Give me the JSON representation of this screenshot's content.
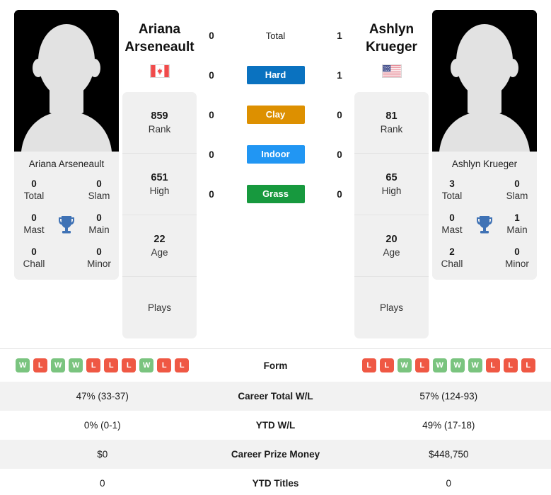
{
  "colors": {
    "hard": "#0a72c0",
    "clay": "#dd9000",
    "indoor": "#2196f3",
    "grass": "#17993e",
    "win": "#7ac47f",
    "loss": "#ef5844",
    "trophy": "#3f72b5",
    "card_bg": "#f0f0f0",
    "row_alt": "#f2f2f2"
  },
  "player1": {
    "name": "Ariana Arseneault",
    "first_name": "Ariana",
    "last_name": "Arseneault",
    "country": "Canada",
    "flag_icon": "flag-canada-icon",
    "avatar_icon": "player-silhouette-icon",
    "rank": "859",
    "rank_label": "Rank",
    "high": "651",
    "high_label": "High",
    "age": "22",
    "age_label": "Age",
    "plays": "",
    "plays_label": "Plays",
    "titles": {
      "total": "0",
      "total_label": "Total",
      "slam": "0",
      "slam_label": "Slam",
      "mast": "0",
      "mast_label": "Mast",
      "main": "0",
      "main_label": "Main",
      "chall": "0",
      "chall_label": "Chall",
      "minor": "0",
      "minor_label": "Minor"
    },
    "h2h": {
      "total": "0",
      "hard": "0",
      "clay": "0",
      "indoor": "0",
      "grass": "0"
    },
    "form": [
      "W",
      "L",
      "W",
      "W",
      "L",
      "L",
      "L",
      "W",
      "L",
      "L"
    ],
    "career_total_wl": "47% (33-37)",
    "ytd_wl": "0% (0-1)",
    "career_prize_money": "$0",
    "ytd_titles": "0"
  },
  "player2": {
    "name": "Ashlyn Krueger",
    "first_name": "Ashlyn",
    "last_name": "Krueger",
    "country": "United States",
    "flag_icon": "flag-usa-icon",
    "avatar_icon": "player-silhouette-icon",
    "rank": "81",
    "rank_label": "Rank",
    "high": "65",
    "high_label": "High",
    "age": "20",
    "age_label": "Age",
    "plays": "",
    "plays_label": "Plays",
    "titles": {
      "total": "3",
      "total_label": "Total",
      "slam": "0",
      "slam_label": "Slam",
      "mast": "0",
      "mast_label": "Mast",
      "main": "1",
      "main_label": "Main",
      "chall": "2",
      "chall_label": "Chall",
      "minor": "0",
      "minor_label": "Minor"
    },
    "h2h": {
      "total": "1",
      "hard": "1",
      "clay": "0",
      "indoor": "0",
      "grass": "0"
    },
    "form": [
      "L",
      "L",
      "W",
      "L",
      "W",
      "W",
      "W",
      "L",
      "L",
      "L"
    ],
    "career_total_wl": "57% (124-93)",
    "ytd_wl": "49% (17-18)",
    "career_prize_money": "$448,750",
    "ytd_titles": "0"
  },
  "surfaces": {
    "total_label": "Total",
    "hard_label": "Hard",
    "clay_label": "Clay",
    "indoor_label": "Indoor",
    "grass_label": "Grass"
  },
  "table": {
    "form_label": "Form",
    "career_total_wl_label": "Career Total W/L",
    "ytd_wl_label": "YTD W/L",
    "career_prize_money_label": "Career Prize Money",
    "ytd_titles_label": "YTD Titles"
  }
}
